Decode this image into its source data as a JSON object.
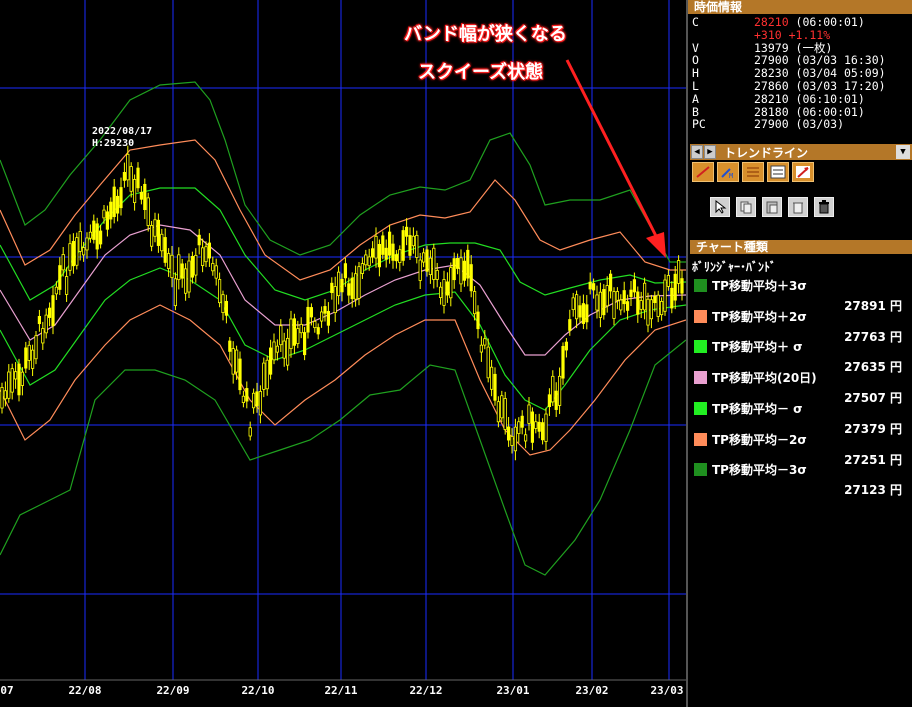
{
  "chart": {
    "x_ticks": [
      "07",
      "22/08",
      "22/09",
      "22/10",
      "22/11",
      "22/12",
      "23/01",
      "23/02",
      "23/03"
    ],
    "peak_label_date": "2022/08/17",
    "peak_label_value": "H:29230",
    "annotation_line1": "バンド幅が狭くなる",
    "annotation_line2": "スクイーズ状態",
    "colors": {
      "grid": "#1a2cff",
      "candle": "#ffff00",
      "sigma3": "#1fa01f",
      "sigma2": "#ff8c5a",
      "sigma1": "#22dd22",
      "ma20": "#e9a0d0",
      "arrow": "#ff2020"
    }
  },
  "quote": {
    "header": "時価情報",
    "rows": [
      {
        "key": "C",
        "value": "28210",
        "extra": " (06:00:01)",
        "red": true
      },
      {
        "key": "",
        "value": "+310 +1.11%",
        "extra": "",
        "red": true
      },
      {
        "key": "V",
        "value": "13979",
        "extra": " (一枚)",
        "red": false
      },
      {
        "key": "O",
        "value": "27900",
        "extra": " (03/03 16:30)",
        "red": false
      },
      {
        "key": "H",
        "value": "28230",
        "extra": " (03/04 05:09)",
        "red": false
      },
      {
        "key": "L",
        "value": "27860",
        "extra": " (03/03 17:20)",
        "red": false
      },
      {
        "key": "A",
        "value": "28210",
        "extra": " (06:10:01)",
        "red": false
      },
      {
        "key": "B",
        "value": "28180",
        "extra": " (06:00:01)",
        "red": false
      },
      {
        "key": "PC",
        "value": "27900",
        "extra": " (03/03)",
        "red": false
      }
    ]
  },
  "trendline": {
    "label": "トレンドライン",
    "prev": "◀",
    "next": "▶",
    "dropdown": "▼"
  },
  "chart_type": {
    "header": "チャート種類",
    "name": "ﾎﾞﾘﾝｼﾞｬｰ･ﾊﾞﾝﾄﾞ",
    "legend": [
      {
        "label": "TP移動平均＋3σ",
        "value": "27891 円",
        "color": "#1f8f1f"
      },
      {
        "label": "TP移動平均＋2σ",
        "value": "27763 円",
        "color": "#ff8c5a"
      },
      {
        "label": "TP移動平均＋ σ",
        "value": "27635 円",
        "color": "#22ee22"
      },
      {
        "label": "TP移動平均(20日)",
        "value": "27507 円",
        "color": "#e9a0d0"
      },
      {
        "label": "TP移動平均－ σ",
        "value": "27379 円",
        "color": "#22ee22"
      },
      {
        "label": "TP移動平均－2σ",
        "value": "27251 円",
        "color": "#ff8c5a"
      },
      {
        "label": "TP移動平均－3σ",
        "value": "27123 円",
        "color": "#1f8f1f"
      }
    ]
  }
}
